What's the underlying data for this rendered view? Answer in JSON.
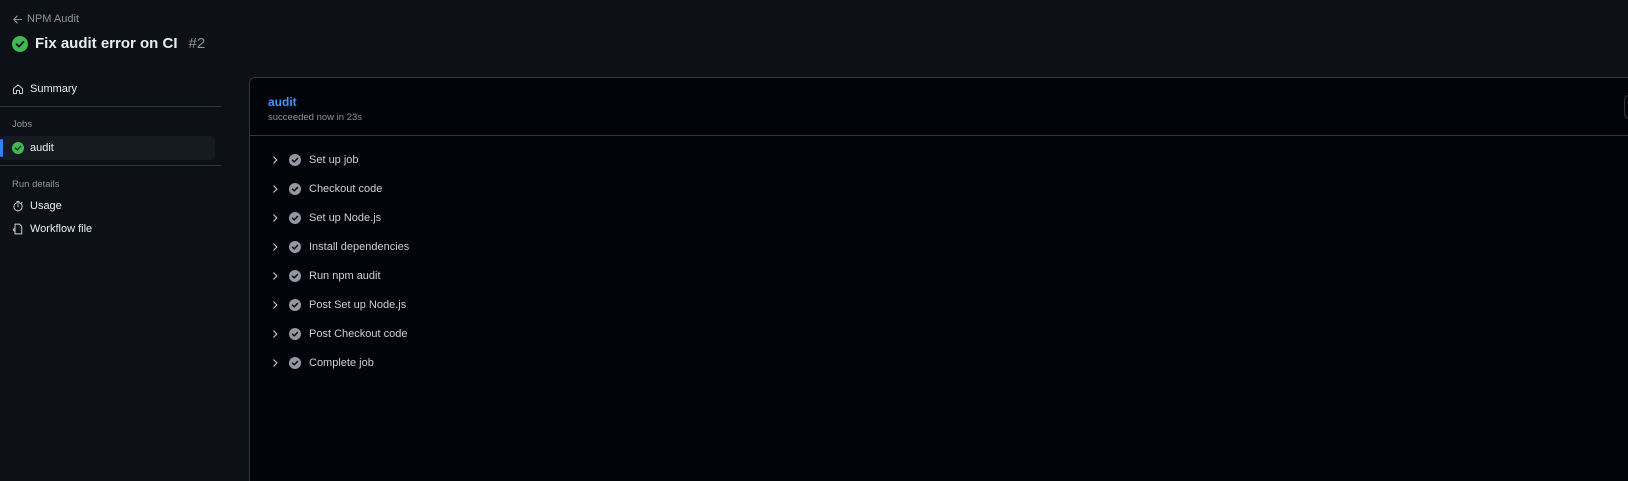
{
  "header": {
    "back_label": "NPM Audit",
    "title": "Fix audit error on CI",
    "run_number": "#2"
  },
  "sidebar": {
    "summary_label": "Summary",
    "jobs_section": "Jobs",
    "jobs": [
      {
        "label": "audit",
        "status": "success"
      }
    ],
    "run_details_section": "Run details",
    "usage_label": "Usage",
    "workflow_file_label": "Workflow file"
  },
  "job": {
    "name": "audit",
    "status": "succeeded now in 23s",
    "steps": [
      {
        "label": "Set up job"
      },
      {
        "label": "Checkout code"
      },
      {
        "label": "Set up Node.js"
      },
      {
        "label": "Install dependencies"
      },
      {
        "label": "Run npm audit"
      },
      {
        "label": "Post Set up Node.js"
      },
      {
        "label": "Post Checkout code"
      },
      {
        "label": "Complete job"
      }
    ]
  },
  "colors": {
    "success": "#3fb950",
    "accent": "#2f81f7",
    "link": "#4493f8",
    "background": "#0d1117",
    "panel": "#010409",
    "muted": "#8b949e"
  }
}
